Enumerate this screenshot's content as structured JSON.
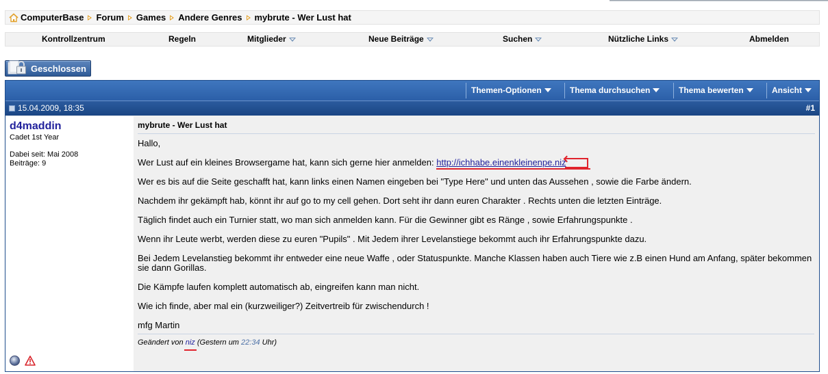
{
  "breadcrumb": {
    "items": [
      "ComputerBase",
      "Forum",
      "Games",
      "Andere Genres",
      "mybrute - Wer Lust hat"
    ]
  },
  "navbar": {
    "items": [
      {
        "label": "Kontrollzentrum",
        "dropdown": false
      },
      {
        "label": "Regeln",
        "dropdown": false
      },
      {
        "label": "Mitglieder",
        "dropdown": true
      },
      {
        "label": "Neue Beiträge",
        "dropdown": true
      },
      {
        "label": "Suchen",
        "dropdown": true
      },
      {
        "label": "Nützliche Links",
        "dropdown": true
      },
      {
        "label": "Abmelden",
        "dropdown": false
      }
    ]
  },
  "closed_button": {
    "label": "Geschlossen"
  },
  "thread_tools": [
    {
      "label": "Themen-Optionen"
    },
    {
      "label": "Thema durchsuchen"
    },
    {
      "label": "Thema bewerten"
    },
    {
      "label": "Ansicht"
    }
  ],
  "post": {
    "date": "15.04.2009, 18:35",
    "number": "#1",
    "user": {
      "name": "d4maddin",
      "title": "Cadet 1st Year",
      "joined": "Dabei seit: Mai 2008",
      "posts": "Beiträge: 9"
    },
    "title": "mybrute - Wer Lust hat",
    "message": {
      "greeting": "Hallo,",
      "intro": "Wer Lust auf ein kleines Browsergame hat, kann sich gerne hier anmelden:",
      "link": "http://ichhabe.einenkleinenpe.niz",
      "p1": "Wer es bis auf die Seite geschafft hat, kann links einen Namen eingeben bei \"Type Here\" und unten das Aussehen , sowie die Farbe ändern.",
      "p2": "Nachdem ihr gekämpft hab, könnt ihr auf go to my cell gehen. Dort seht ihr dann euren Charakter . Rechts unten die letzten Einträge.",
      "p3": "Täglich findet auch ein Turnier statt, wo man sich anmelden kann. Für die Gewinner gibt es Ränge , sowie Erfahrungspunkte .",
      "p4": "Wenn ihr Leute werbt, werden diese zu euren \"Pupils\" . Mit Jedem ihrer Levelanstiege bekommt auch ihr Erfahrungspunkte dazu.",
      "p5": "Bei Jedem Levelanstieg bekommt ihr entweder eine neue Waffe , oder Statuspunkte. Manche Klassen haben auch Tiere wie z.B einen Hund am Anfang, später bekommen sie dann Gorillas.",
      "p6": "Die Kämpfe laufen komplett automatisch ab, eingreifen kann man nicht.",
      "p7": "Wie ich finde, aber mal ein (kurzweiliger?) Zeitvertreib für zwischendurch !",
      "signoff": "mfg Martin"
    },
    "edit": {
      "prefix": "Geändert von",
      "editor": "niz",
      "middle": "(Gestern um",
      "time": "22:34",
      "suffix": "Uhr)"
    }
  },
  "icons": [
    "home-icon",
    "lock-icon",
    "post-icon",
    "online-status-icon",
    "report-icon"
  ],
  "colors": {
    "header_blue": "#2b5fa8",
    "link_blue": "#22229c",
    "annotation_red": "#e0232c",
    "breadcrumb_arrow": "#e2a12b"
  }
}
